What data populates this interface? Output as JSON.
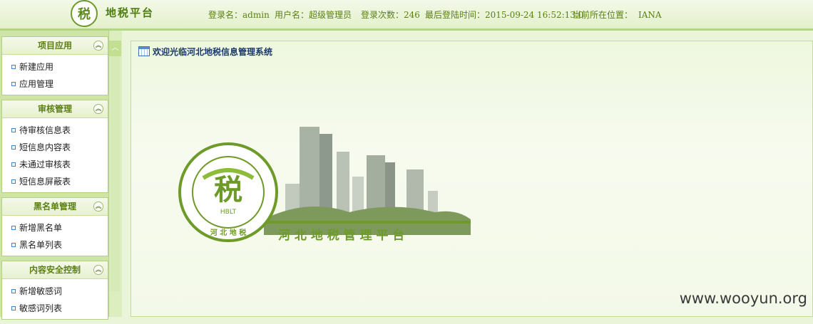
{
  "header": {
    "brand": "地税平台",
    "logo_glyph": "税",
    "info": [
      {
        "label": "登录名：",
        "value": "admin"
      },
      {
        "label": "用户名：",
        "value": "超级管理员"
      },
      {
        "label": "登录次数：",
        "value": "246"
      },
      {
        "label": "最后登陆时间：",
        "value": "2015-09-24 16:52:13.0"
      },
      {
        "label": "当前所在位置：",
        "value": "IANA"
      }
    ]
  },
  "sidebar": {
    "groups": [
      {
        "title": "项目应用",
        "items": [
          "新建应用",
          "应用管理"
        ]
      },
      {
        "title": "审核管理",
        "items": [
          "待审核信息表",
          "短信息内容表",
          "未通过审核表",
          "短信息屏蔽表"
        ]
      },
      {
        "title": "黑名单管理",
        "items": [
          "新增黑名单",
          "黑名单列表"
        ]
      },
      {
        "title": "内容安全控制",
        "items": [
          "新增敏感词",
          "敏感词列表"
        ]
      }
    ]
  },
  "main": {
    "title": "欢迎光临河北地税信息管理系统",
    "emblem_glyph": "税",
    "emblem_code": "HBLT",
    "emblem_ring": "河 北 地 税",
    "platform_name": "河 北 地 税 管 理 平 台"
  },
  "watermark": "www.wooyun.org",
  "colors": {
    "accent": "#6e9a2a",
    "text_green": "#5b7f14",
    "title_blue": "#1c3a6a"
  }
}
